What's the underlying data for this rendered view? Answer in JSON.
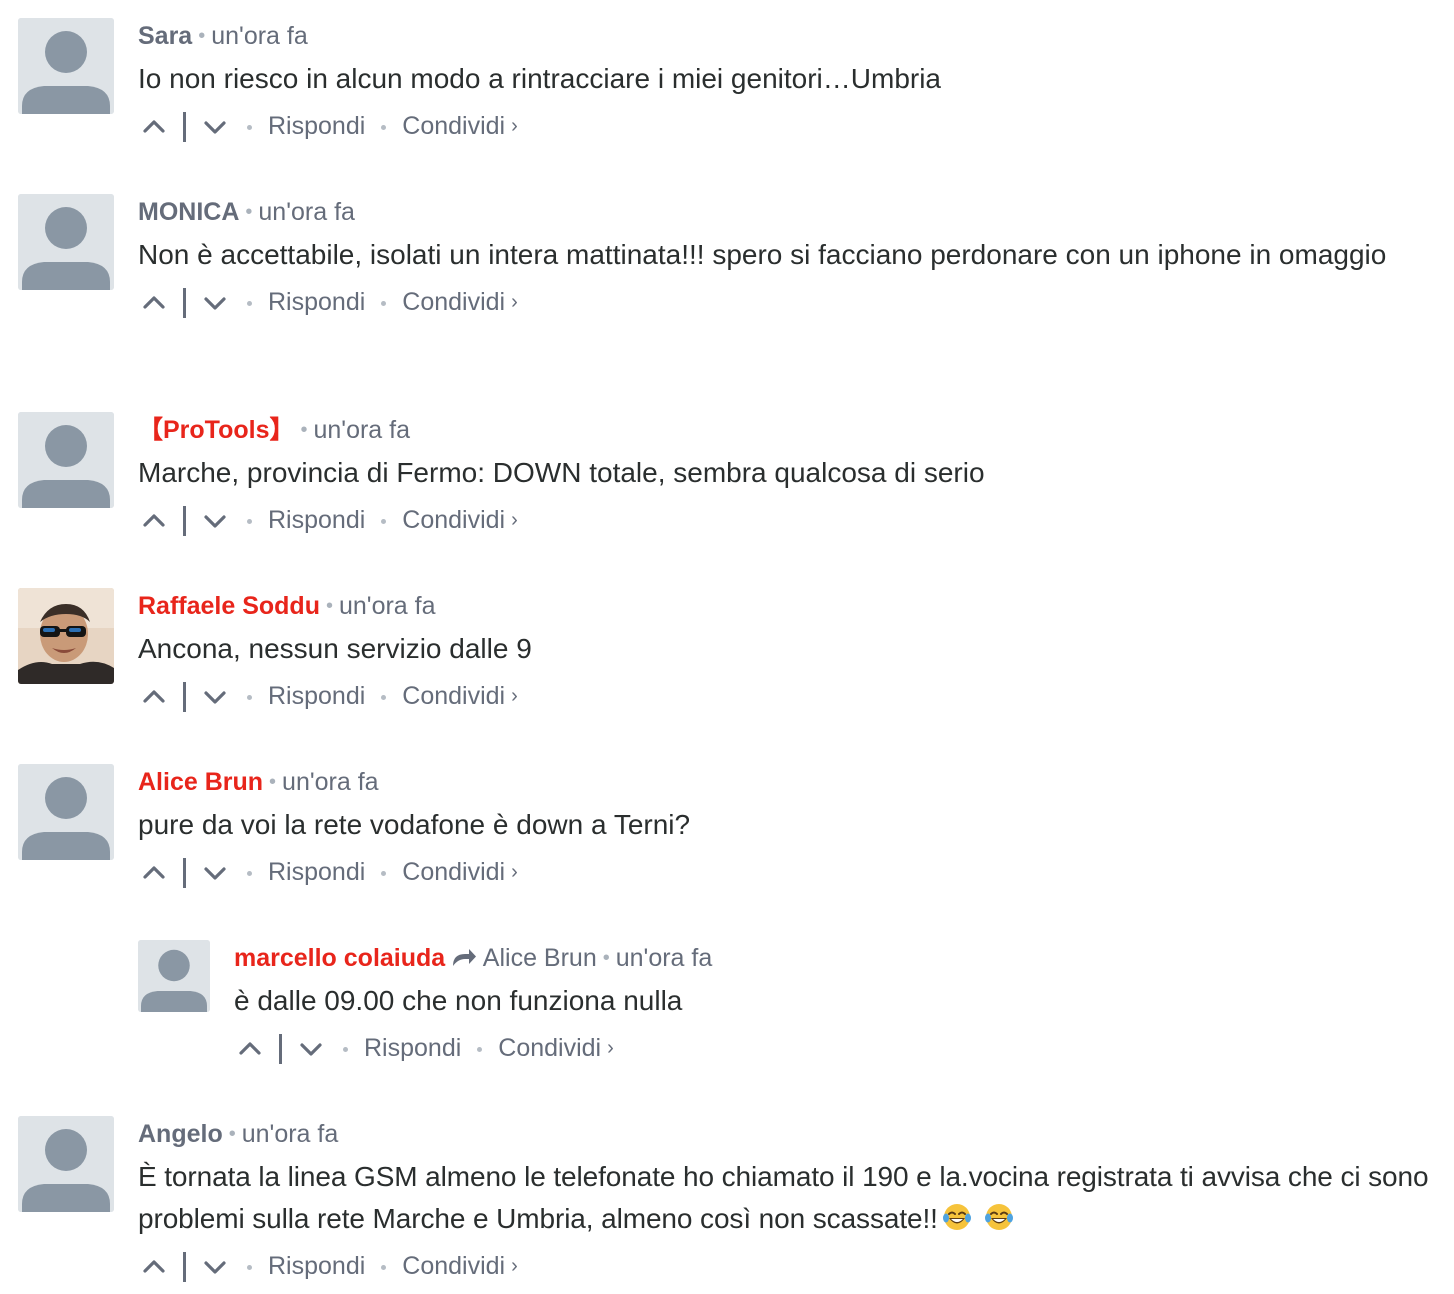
{
  "colors": {
    "muted": "#656c7a",
    "accent_red": "#e8251b",
    "text": "#2a2e2e",
    "avatar_bg": "#dee3e7",
    "avatar_fg": "#8a97a4"
  },
  "actions": {
    "reply": "Rispondi",
    "share": "Condividi",
    "share_chevron": "›",
    "upvote_icon": "chevron-up-icon",
    "downvote_icon": "chevron-down-icon"
  },
  "comments": [
    {
      "author": "Sara",
      "author_highlight": false,
      "time": "un'ora fa",
      "text": "Io non riesco in alcun modo a rintracciare i miei genitori…Umbria"
    },
    {
      "author": "MONICA",
      "author_highlight": false,
      "time": "un'ora fa",
      "text": "Non è accettabile, isolati un intera mattinata!!! spero si facciano perdonare con un iphone in omaggio"
    },
    {
      "author": "【ProTools】",
      "author_highlight": true,
      "time": "un'ora fa",
      "text": "Marche, provincia di Fermo: DOWN totale, sembra qualcosa di serio"
    },
    {
      "author": "Raffaele Soddu",
      "author_highlight": true,
      "time": "un'ora fa",
      "text": "Ancona, nessun servizio dalle 9",
      "avatar": "photo"
    },
    {
      "author": "Alice Brun",
      "author_highlight": true,
      "time": "un'ora fa",
      "text": "pure da voi la rete vodafone è down a Terni?"
    },
    {
      "author": "marcello colaiuda",
      "author_highlight": true,
      "reply_to": "Alice Brun",
      "time": "un'ora fa",
      "text": "è dalle 09.00 che non funziona nulla"
    },
    {
      "author": "Angelo",
      "author_highlight": false,
      "time": "un'ora fa",
      "text": "È tornata la linea GSM almeno le telefonate ho chiamato il 190 e la.vocina registrata ti avvisa che ci sono problemi sulla rete Marche e Umbria, almeno così non scassate!!",
      "trailing_icons": [
        "laughing-tears-emoji-icon",
        "laughing-tears-emoji-icon"
      ]
    }
  ]
}
